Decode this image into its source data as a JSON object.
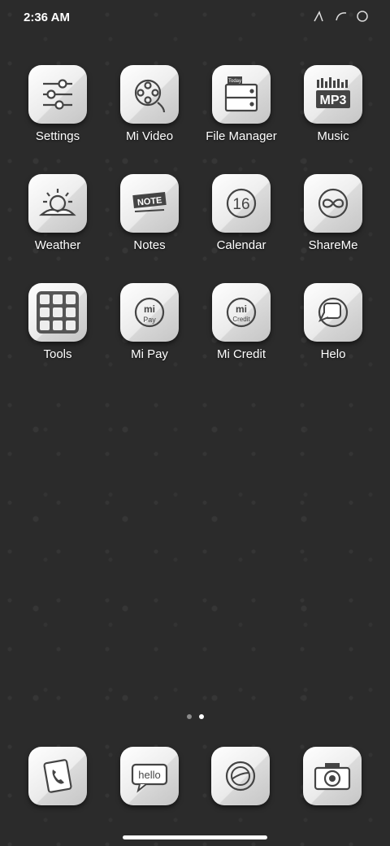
{
  "status": {
    "time": "2:36 AM"
  },
  "apps": [
    {
      "label": "Settings",
      "icon": "sliders-icon"
    },
    {
      "label": "Mi Video",
      "icon": "film-reel-icon"
    },
    {
      "label": "File Manager",
      "icon": "file-cabinet-icon"
    },
    {
      "label": "Music",
      "icon": "mp3-icon"
    },
    {
      "label": "Weather",
      "icon": "sunrise-icon"
    },
    {
      "label": "Notes",
      "icon": "note-icon"
    },
    {
      "label": "Calendar",
      "icon": "calendar-16-icon"
    },
    {
      "label": "ShareMe",
      "icon": "infinity-icon"
    },
    {
      "label": "Tools",
      "icon": "tools-grid-icon"
    },
    {
      "label": "Mi Pay",
      "icon": "mi-pay-icon"
    },
    {
      "label": "Mi Credit",
      "icon": "mi-credit-icon"
    },
    {
      "label": "Helo",
      "icon": "chat-bubbles-icon"
    }
  ],
  "icon_text": {
    "today": "Today",
    "mp3": "MP3",
    "note": "NOTE",
    "calendar_day": "16",
    "mi": "mi",
    "pay": "Pay",
    "credit": "Credit",
    "hello": "hello"
  },
  "pager": {
    "pages": 2,
    "current": 2
  },
  "dock": [
    {
      "icon": "phone-icon"
    },
    {
      "icon": "hello-message-icon"
    },
    {
      "icon": "browser-globe-icon"
    },
    {
      "icon": "camera-icon"
    }
  ]
}
